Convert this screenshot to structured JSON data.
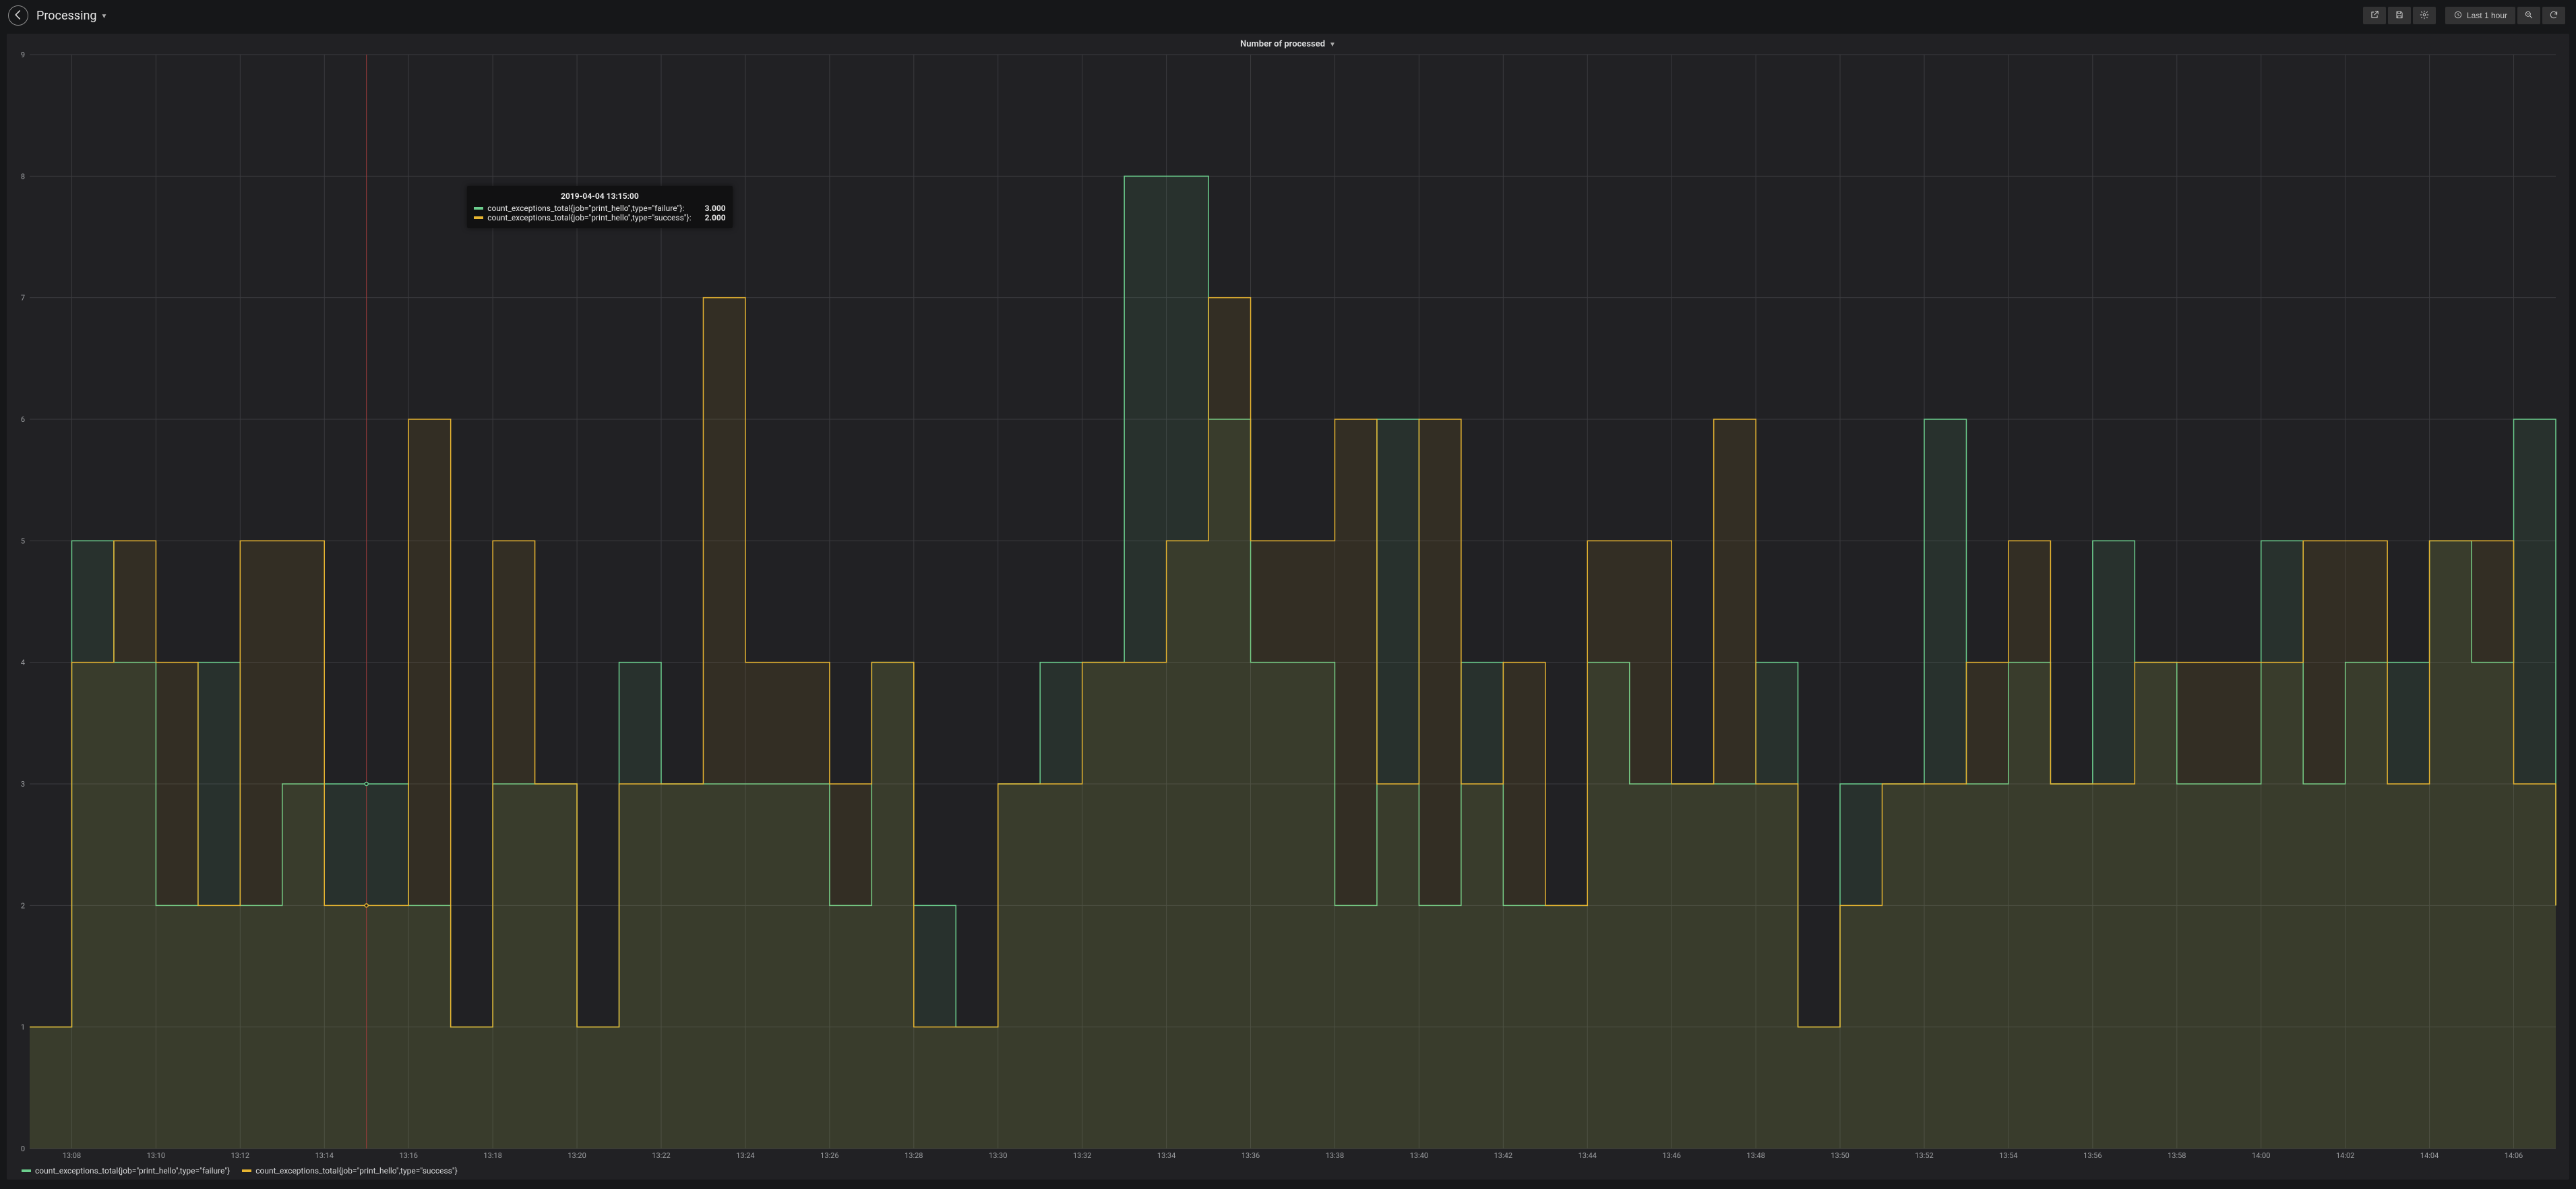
{
  "header": {
    "dashboard_title": "Processing",
    "time_range_label": "Last 1 hour"
  },
  "panel": {
    "title": "Number of processed"
  },
  "tooltip": {
    "timestamp": "2019-04-04 13:15:00",
    "rows": [
      {
        "swatch": "#6ccf8e",
        "label": "count_exceptions_total{job=\"print_hello\",type=\"failure\"}:",
        "value": "3.000"
      },
      {
        "swatch": "#e7b531",
        "label": "count_exceptions_total{job=\"print_hello\",type=\"success\"}:",
        "value": "2.000"
      }
    ],
    "x_category": "13:15",
    "pos": {
      "left_pct": 17.8,
      "top_pct": 12.2
    }
  },
  "legend": [
    {
      "swatch": "#6ccf8e",
      "label": "count_exceptions_total{job=\"print_hello\",type=\"failure\"}"
    },
    {
      "swatch": "#e7b531",
      "label": "count_exceptions_total{job=\"print_hello\",type=\"success\"}"
    }
  ],
  "chart_data": {
    "type": "line",
    "step": true,
    "title": "Number of processed",
    "xlabel": "",
    "ylabel": "",
    "ylim": [
      0,
      9
    ],
    "yticks": [
      0,
      1,
      2,
      3,
      4,
      5,
      6,
      7,
      8,
      9
    ],
    "x_tick_labels": [
      "13:08",
      "13:10",
      "13:12",
      "13:14",
      "13:16",
      "13:18",
      "13:20",
      "13:22",
      "13:24",
      "13:26",
      "13:28",
      "13:30",
      "13:32",
      "13:34",
      "13:36",
      "13:38",
      "13:40",
      "13:42",
      "13:44",
      "13:46",
      "13:48",
      "13:50",
      "13:52",
      "13:54",
      "13:56",
      "13:58",
      "14:00",
      "14:02",
      "14:04",
      "14:06"
    ],
    "categories": [
      "13:07",
      "13:08",
      "13:09",
      "13:10",
      "13:11",
      "13:12",
      "13:13",
      "13:14",
      "13:15",
      "13:16",
      "13:17",
      "13:18",
      "13:19",
      "13:20",
      "13:21",
      "13:22",
      "13:23",
      "13:24",
      "13:25",
      "13:26",
      "13:27",
      "13:28",
      "13:29",
      "13:30",
      "13:31",
      "13:32",
      "13:33",
      "13:34",
      "13:35",
      "13:36",
      "13:37",
      "13:38",
      "13:39",
      "13:40",
      "13:41",
      "13:42",
      "13:43",
      "13:44",
      "13:45",
      "13:46",
      "13:47",
      "13:48",
      "13:49",
      "13:50",
      "13:51",
      "13:52",
      "13:53",
      "13:54",
      "13:55",
      "13:56",
      "13:57",
      "13:58",
      "13:59",
      "14:00",
      "14:01",
      "14:02",
      "14:03",
      "14:04",
      "14:05",
      "14:06",
      "14:07"
    ],
    "series": [
      {
        "name": "count_exceptions_total{job=\"print_hello\",type=\"failure\"}",
        "color": "#6ccf8e",
        "fill": "rgba(108,207,142,0.09)",
        "values": [
          1,
          5,
          4,
          2,
          4,
          2,
          3,
          3,
          3,
          2,
          1,
          3,
          3,
          1,
          4,
          3,
          3,
          3,
          3,
          2,
          4,
          2,
          1,
          3,
          4,
          4,
          8,
          8,
          6,
          4,
          4,
          2,
          6,
          2,
          4,
          2,
          2,
          4,
          3,
          3,
          3,
          4,
          1,
          3,
          3,
          6,
          3,
          4,
          3,
          5,
          4,
          3,
          3,
          5,
          3,
          4,
          4,
          5,
          4,
          6,
          2
        ]
      },
      {
        "name": "count_exceptions_total{job=\"print_hello\",type=\"success\"}",
        "color": "#e7b531",
        "fill": "rgba(231,181,49,0.09)",
        "values": [
          1,
          4,
          5,
          4,
          2,
          5,
          5,
          2,
          2,
          6,
          1,
          5,
          3,
          1,
          3,
          3,
          7,
          4,
          4,
          3,
          4,
          1,
          1,
          3,
          3,
          4,
          4,
          5,
          7,
          5,
          5,
          6,
          3,
          6,
          3,
          4,
          2,
          5,
          5,
          3,
          6,
          3,
          1,
          2,
          3,
          3,
          4,
          5,
          3,
          3,
          4,
          4,
          4,
          4,
          5,
          5,
          3,
          5,
          5,
          3,
          2
        ]
      }
    ],
    "crosshair_category": "13:15",
    "crosshair_color": "#a33c3c"
  }
}
